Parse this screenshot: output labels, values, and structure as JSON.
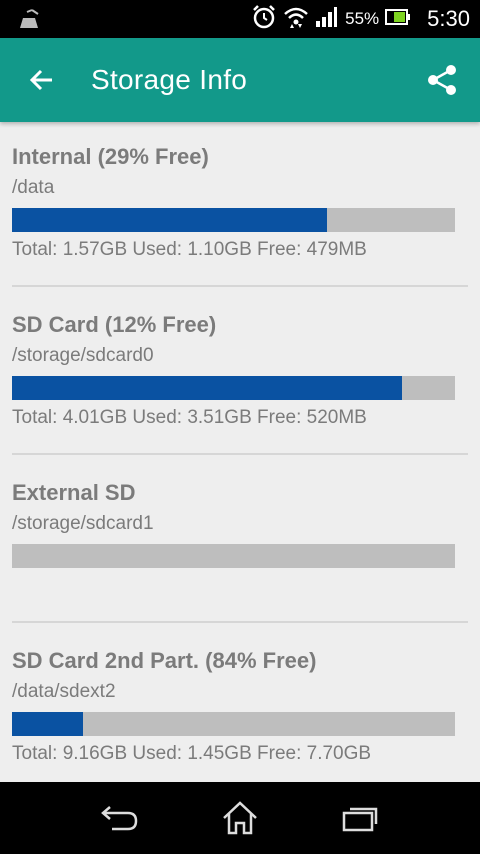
{
  "status_bar": {
    "battery_percent": "55%",
    "time": "5:30",
    "icons": [
      "cleaner-icon",
      "alarm-icon",
      "wifi-icon",
      "signal-icon",
      "battery-icon"
    ]
  },
  "app_bar": {
    "title": "Storage Info",
    "back_icon": "arrow-left-icon",
    "share_icon": "share-icon",
    "background_color": "#12998a"
  },
  "colors": {
    "used_bar": "#0a52a2",
    "free_bar": "#bebebe",
    "text": "#7b7b7b"
  },
  "storages": [
    {
      "title": "Internal (29% Free)",
      "path": "/data",
      "used_fraction": 0.71,
      "stats": "Total: 1.57GB Used: 1.10GB Free: 479MB"
    },
    {
      "title": "SD Card (12% Free)",
      "path": "/storage/sdcard0",
      "used_fraction": 0.88,
      "stats": "Total: 4.01GB Used: 3.51GB Free: 520MB"
    },
    {
      "title": "External SD",
      "path": "/storage/sdcard1",
      "used_fraction": 0,
      "stats": ""
    },
    {
      "title": "SD Card 2nd Part. (84% Free)",
      "path": "/data/sdext2",
      "used_fraction": 0.16,
      "stats": "Total: 9.16GB Used: 1.45GB Free: 7.70GB"
    }
  ],
  "nav_bar": {
    "icons": [
      "back-icon",
      "home-icon",
      "recent-apps-icon"
    ]
  }
}
